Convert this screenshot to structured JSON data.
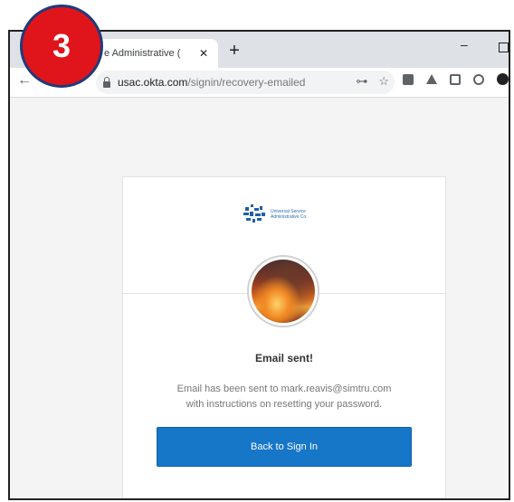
{
  "step_badge": {
    "number": "3",
    "color": "#e0141b"
  },
  "browser": {
    "tab": {
      "title": "e Administrative (",
      "close_glyph": "✕"
    },
    "new_tab_glyph": "+",
    "window_controls": {
      "minimize_glyph": "–"
    },
    "back_glyph": "←",
    "url": {
      "host": "usac.okta.com",
      "path": "/signin/recovery-emailed"
    },
    "omnibox_icons": {
      "key": "⊶",
      "star": "☆"
    }
  },
  "page": {
    "brand": {
      "line1": "Universal Service",
      "line2": "Administrative Co.",
      "color": "#2d6db5"
    },
    "heading": "Email sent!",
    "message_line1": "Email has been sent to mark.reavis@simtru.com",
    "message_line2": "with instructions on resetting your password.",
    "button_label": "Back to Sign In",
    "accent_color": "#1676c8"
  }
}
